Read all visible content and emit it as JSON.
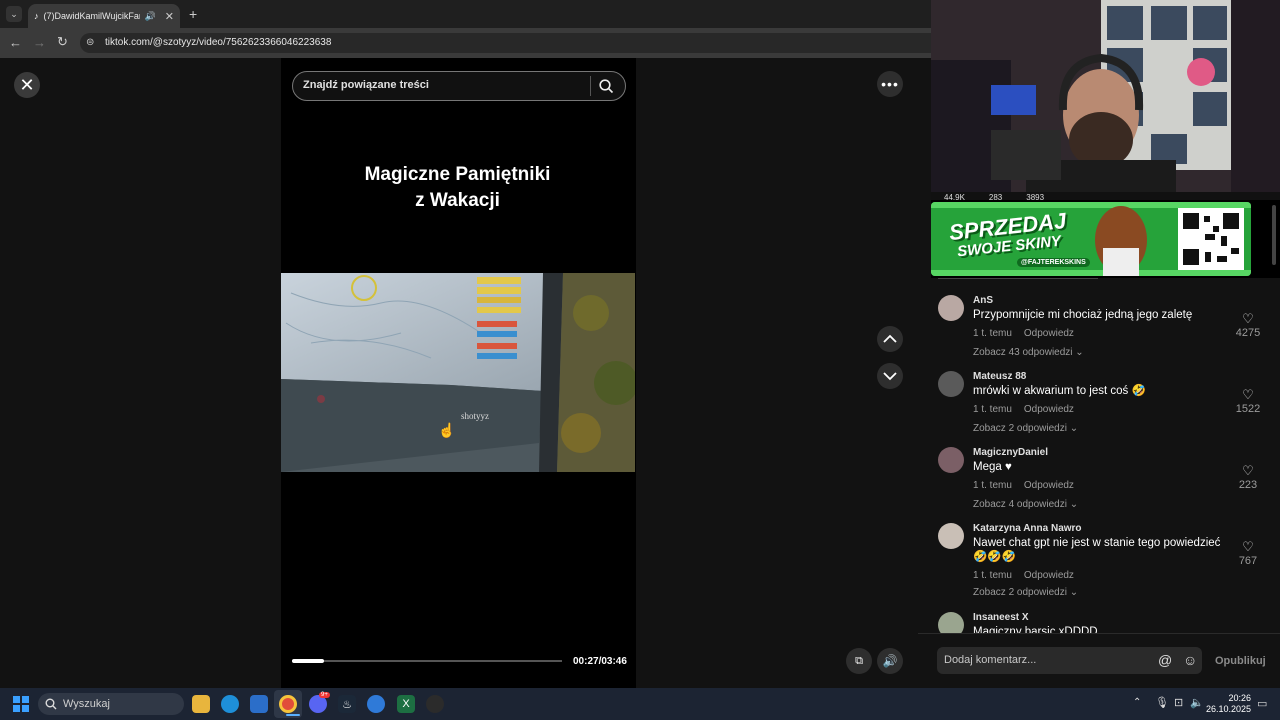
{
  "browser": {
    "tab_title": "(7)DawidKamilWujcikFamel",
    "url": "tiktok.com/@szotyyz/video/7562623366046223638"
  },
  "video": {
    "search_placeholder": "Znajdź powiązane treści",
    "title_line1": "Magiczne Pamiętniki",
    "title_line2": "z Wakacji",
    "watermark": "shotyyz",
    "time": "00:27/03:46",
    "progress_fraction": 0.12
  },
  "comments": [
    {
      "user": "AnS",
      "text": "Przypomnijcie mi chociaż jedną jego zaletę",
      "time": "1 t. temu",
      "reply": "Odpowiedz",
      "more": "Zobacz 43 odpowiedzi",
      "likes": "4275"
    },
    {
      "user": "Mateusz 88",
      "text": "mrówki w akwarium to jest coś 🤣",
      "time": "1 t. temu",
      "reply": "Odpowiedz",
      "more": "Zobacz 2 odpowiedzi",
      "likes": "1522"
    },
    {
      "user": "MagicznyDaniel",
      "text": "Mega ♥",
      "time": "1 t. temu",
      "reply": "Odpowiedz",
      "more": "Zobacz 4 odpowiedzi",
      "likes": "223"
    },
    {
      "user": "Katarzyna Anna Nawro",
      "text": "Nawet chat gpt nie jest w stanie tego powiedzieć 🤣🤣🤣",
      "time": "1 t. temu",
      "reply": "Odpowiedz",
      "more": "Zobacz 2 odpowiedzi",
      "likes": "767"
    },
    {
      "user": "Insaneest X",
      "text": "Magiczny barsic xDDDD",
      "time": "",
      "reply": "",
      "more": "",
      "likes": ""
    }
  ],
  "comment_box": {
    "placeholder": "Dodaj komentarz...",
    "publish": "Opublikuj"
  },
  "banner": {
    "line1": "SPRZEDAJ",
    "line2": "SWOJE SKINY",
    "handle": "@FAJTEREKSKINS"
  },
  "stream_stats": [
    "44.9K",
    "283",
    "3893"
  ],
  "taskbar": {
    "search": "Wyszukaj",
    "time": "20:26",
    "date": "26.10.2025",
    "discord_badge": "9+"
  }
}
